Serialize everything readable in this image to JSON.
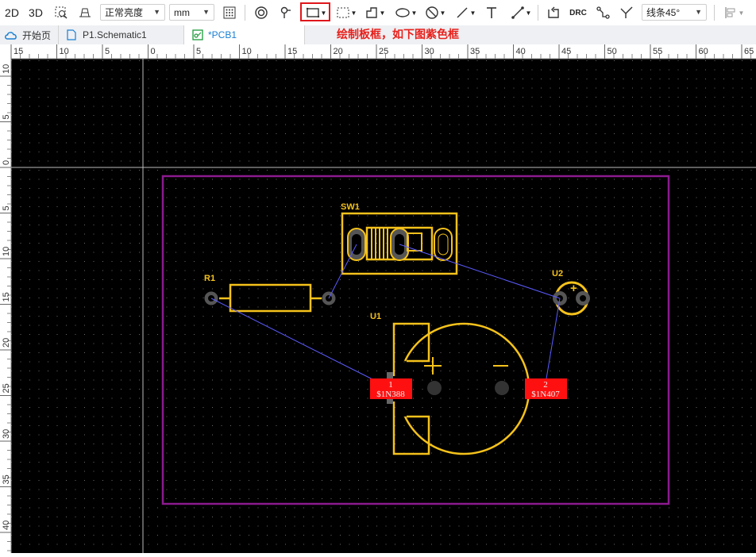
{
  "toolbar": {
    "view2d_label": "2D",
    "view3d_label": "3D",
    "brightness_value": "正常亮度",
    "unit_value": "mm",
    "drc_label": "DRC",
    "route_mode_value": "线条45°"
  },
  "tabs": [
    {
      "label": "开始页"
    },
    {
      "label": "P1.Schematic1"
    },
    {
      "label": "*PCB1"
    }
  ],
  "annotation": "绘制板框，如下图紫色框",
  "ruler": {
    "top_ticks": [
      "15",
      "10",
      "5",
      "0",
      "5",
      "10",
      "15",
      "20",
      "25",
      "30",
      "35",
      "40",
      "45",
      "50",
      "55",
      "60",
      "65"
    ],
    "left_ticks": [
      "10",
      "5",
      "0",
      "5",
      "10",
      "15",
      "20",
      "25",
      "30",
      "35",
      "40"
    ]
  },
  "components": {
    "sw1": "SW1",
    "r1": "R1",
    "u1": "U1",
    "u2": "U2",
    "u2_plus": "+",
    "u1_plus": "+",
    "u1_minus": "—"
  },
  "pads": {
    "pad1_num": "1",
    "pad1_net": "$1N388",
    "pad2_num": "2",
    "pad2_net": "$1N407"
  },
  "colors": {
    "board_outline": "#8b1a8f",
    "silkscreen": "#f5c21b",
    "ratsnest": "#5b5bff",
    "pad_highlight": "#ff1010",
    "annotation": "#e8201c",
    "tool_highlight": "#e0161b"
  }
}
